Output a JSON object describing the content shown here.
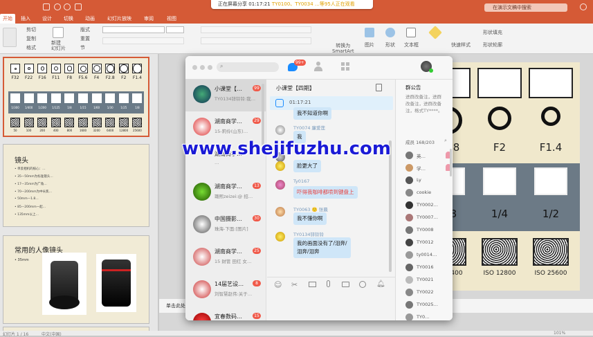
{
  "screen_share": {
    "prefix": "正在屏幕分享",
    "time": "01:17:21",
    "ids": "TY0100、TY0034 …等95人正在观看"
  },
  "search_doc": {
    "placeholder": "在演示文稿中搜索"
  },
  "tabs": [
    {
      "label": "开始"
    },
    {
      "label": "插入"
    },
    {
      "label": "设计"
    },
    {
      "label": "切换"
    },
    {
      "label": "动画"
    },
    {
      "label": "幻灯片放映"
    },
    {
      "label": "审阅"
    },
    {
      "label": "视图"
    }
  ],
  "ribbon": {
    "cut": "剪切",
    "copy": "复制",
    "format": "格式",
    "new_slide": "新建\n幻灯片",
    "layout": "版式",
    "reset": "重置",
    "section": "节",
    "convert": "转换为\nSmartArt",
    "picture": "图片",
    "shape": "形状",
    "textbox": "文本框",
    "quick_style": "快速样式",
    "shape_fill": "形状填充",
    "shape_outline": "形状轮廓"
  },
  "thumb1": {
    "fstops": [
      "F32",
      "F22",
      "F16",
      "F11",
      "F8",
      "F5.6",
      "F4",
      "F2.8",
      "F2",
      "F1.4"
    ],
    "speeds": [
      "1/300",
      "1/400",
      "1/200",
      "1/125",
      "1/8",
      "1/15",
      "1/60",
      "1/30",
      "1/25",
      "1/8"
    ],
    "isos": [
      "50",
      "100",
      "200",
      "400",
      "800",
      "1600",
      "3200",
      "6400",
      "12800",
      "25600"
    ]
  },
  "thumb2": {
    "title": "镜头",
    "lines": [
      "•  单反相机的核心：…",
      "•  35—50mm为标准镜头…",
      "•  17—35mm为广角…",
      "•  70—200mm为中长焦…",
      "•  50mm—1.8…",
      "•  85—200mm一起…",
      "•  135mm以上…"
    ]
  },
  "thumb3": {
    "title": "常用的人像镜头",
    "bullet": "•  35mm"
  },
  "qq": {
    "badge": "99+",
    "conversations": [
      {
        "name": "小课堂【…",
        "preview": "TY0134锌铃铃:我…",
        "badge": "99"
      },
      {
        "name": "湖南商学…",
        "preview": "15-莉伶(山东)…",
        "badge": "29"
      },
      {
        "name": "湖南商学…",
        "preview": "…",
        "badge": ""
      },
      {
        "name": "湖南商学…",
        "preview": "璐熙zeizei:@ 招…",
        "badge": "13"
      },
      {
        "name": "中国摄影…",
        "preview": "珠海-下面:[图片]",
        "badge": "30"
      },
      {
        "name": "湖南商学…",
        "preview": "15 财管 田红 女…",
        "badge": "25"
      },
      {
        "name": "14届艺设…",
        "preview": "刘智慧赵伟:关于…",
        "badge": "8"
      },
      {
        "name": "宜春数码…",
        "preview": "泰国旅行king:😄😄",
        "badge": "15"
      }
    ],
    "chat_title": "小课堂【四期】",
    "pinned_time": "01:17:21",
    "messages": [
      {
        "sender": "",
        "text": "我不知道你啊",
        "red": false
      },
      {
        "sender": "TY0074 廉爱莲",
        "text": "我",
        "red": false
      },
      {
        "sender": "",
        "text": "",
        "red": false
      },
      {
        "sender": "",
        "text": "脸更大了",
        "red": false
      },
      {
        "sender": "Ty0167",
        "text": "吓得我咖啡都喷到键盘上",
        "red": true
      },
      {
        "sender": "TY0063 🙂 张晨",
        "text": "我不懂你啊",
        "red": false
      },
      {
        "sender": "TY0134锌铃铃",
        "text": "我的画面没有了/泪奔/\n泪奔/泪奔",
        "red": false
      }
    ],
    "group_notice_title": "群公告",
    "group_notice": "进群改备注，进群改备注，进群改备注，格式TY****。",
    "members_label": "成员 168/203",
    "members": [
      "英…",
      "学…",
      "Ly",
      "cookie",
      "TY0002…",
      "TY0007…",
      "TY0008",
      "TY0012",
      "ty0014…",
      "TY0016",
      "TY0021",
      "TY0022",
      "TY0025…",
      "TY0…"
    ]
  },
  "slide": {
    "fstops": [
      "F2.8",
      "F2",
      "F1.4"
    ],
    "speeds": [
      "1/8",
      "1/4",
      "1/2"
    ],
    "isos": [
      "ISO 6400",
      "ISO 12800",
      "ISO 25600"
    ]
  },
  "notes": {
    "text": "单击此处添加备注"
  },
  "status": {
    "left": "幻灯片 1 / 16",
    "lang": "中文(中国)",
    "zoom": "101%"
  },
  "watermark": {
    "text": "www.shejifuzhu.com"
  },
  "colors": {
    "accent": "#d55a36",
    "qq_blue": "#1a8cff",
    "badge_red": "#f05a4a",
    "bubble": "#cfe6f8"
  }
}
